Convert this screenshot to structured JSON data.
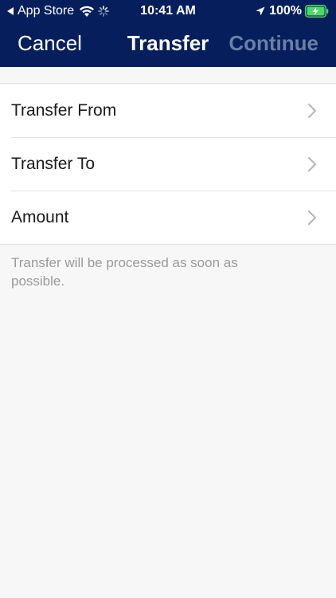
{
  "status_bar": {
    "back_app": "App Store",
    "time": "10:41 AM",
    "battery": "100%"
  },
  "nav": {
    "cancel_label": "Cancel",
    "title": "Transfer",
    "continue_label": "Continue"
  },
  "list": {
    "items": [
      {
        "label": "Transfer From"
      },
      {
        "label": "Transfer To"
      },
      {
        "label": "Amount"
      }
    ]
  },
  "footer": {
    "note": "Transfer will be processed as soon as possible."
  },
  "colors": {
    "header_bg": "#061f5c",
    "continue_disabled": "#6a7fa6",
    "background": "#f7f7f7",
    "battery_charge": "#4cd964"
  }
}
